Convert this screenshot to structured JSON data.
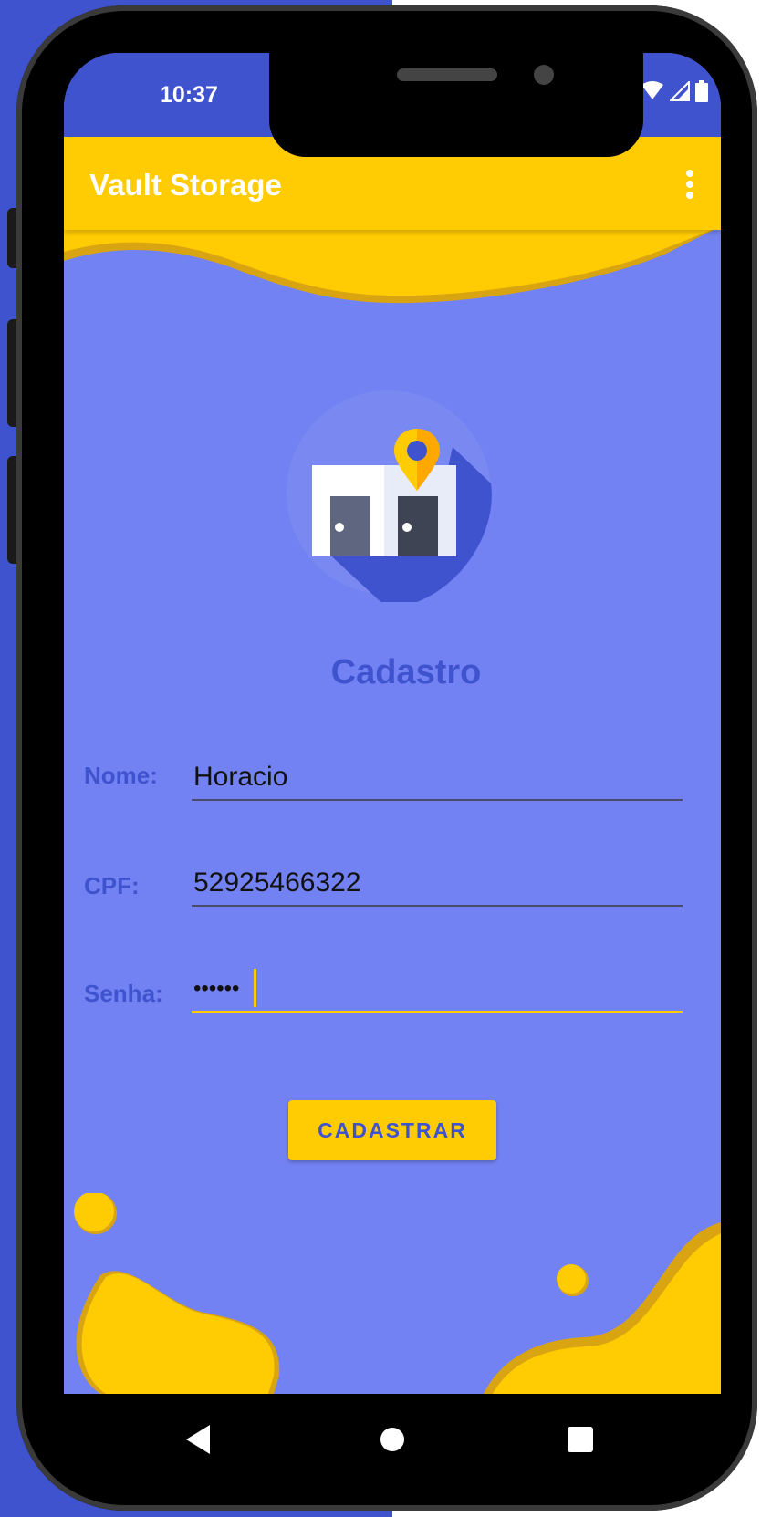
{
  "status_bar": {
    "time": "10:37"
  },
  "app_bar": {
    "title": "Vault Storage"
  },
  "page": {
    "title": "Cadastro"
  },
  "form": {
    "nome": {
      "label": "Nome:",
      "value": "Horacio"
    },
    "cpf": {
      "label": "CPF:",
      "value": "52925466322"
    },
    "senha": {
      "label": "Senha:",
      "value": "••••••"
    }
  },
  "button": {
    "label": "CADASTRAR"
  },
  "colors": {
    "primary": "#4053cf",
    "accent": "#ffcb02",
    "background": "#7382f2"
  }
}
